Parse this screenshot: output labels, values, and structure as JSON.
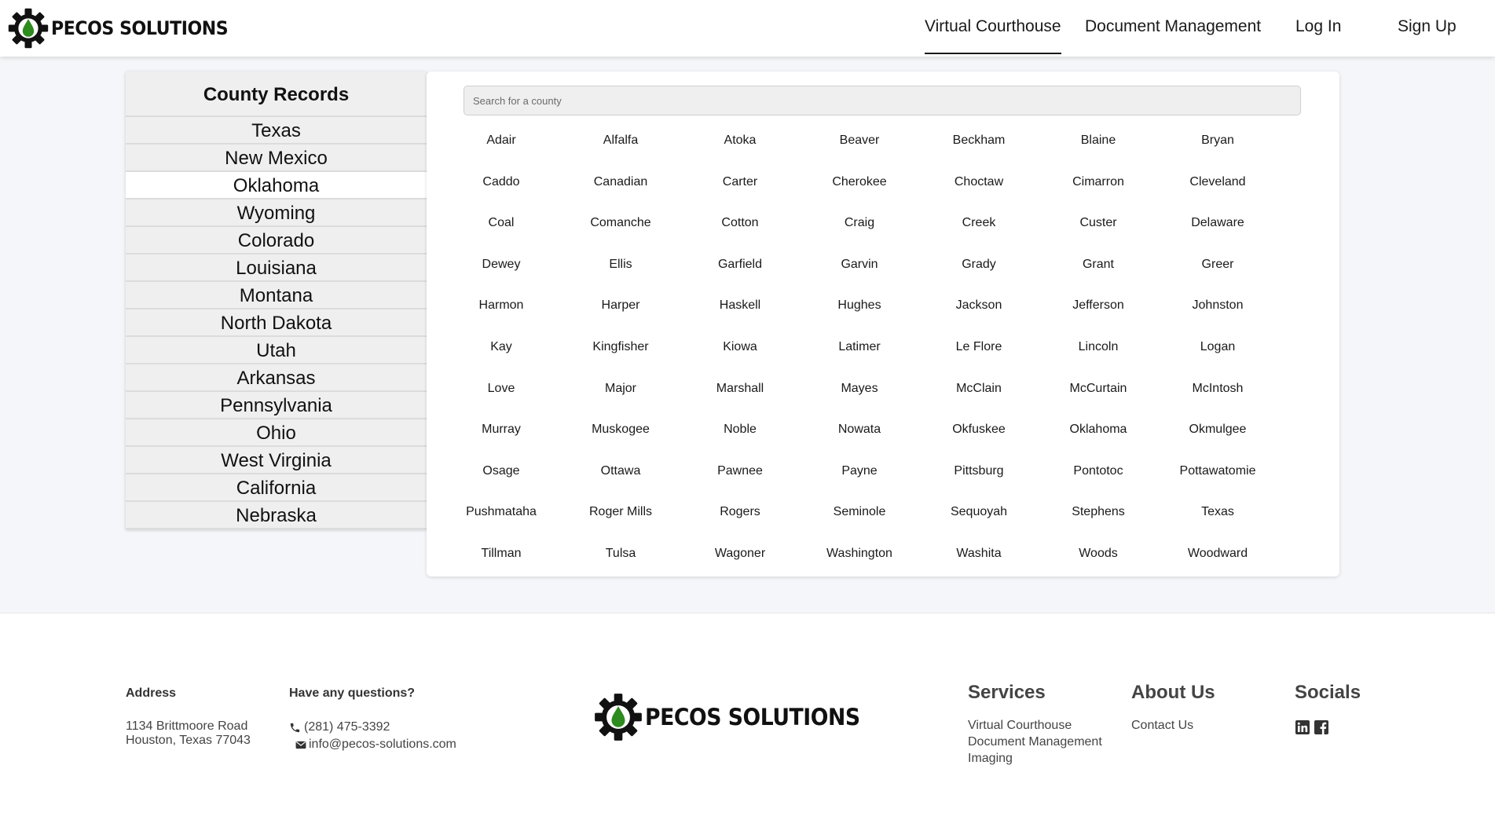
{
  "header": {
    "brand": "PECOS SOLUTIONS",
    "nav": [
      {
        "label": "Virtual Courthouse",
        "active": true
      },
      {
        "label": "Document Management",
        "active": false
      },
      {
        "label": "Log In",
        "active": false
      },
      {
        "label": "Sign Up",
        "active": false
      }
    ]
  },
  "sidebar": {
    "title": "County Records",
    "selected": "Oklahoma",
    "states": [
      "Texas",
      "New Mexico",
      "Oklahoma",
      "Wyoming",
      "Colorado",
      "Louisiana",
      "Montana",
      "North Dakota",
      "Utah",
      "Arkansas",
      "Pennsylvania",
      "Ohio",
      "West Virginia",
      "California",
      "Nebraska"
    ]
  },
  "panel": {
    "search_placeholder": "Search for a county",
    "counties": [
      "Adair",
      "Alfalfa",
      "Atoka",
      "Beaver",
      "Beckham",
      "Blaine",
      "Bryan",
      "Caddo",
      "Canadian",
      "Carter",
      "Cherokee",
      "Choctaw",
      "Cimarron",
      "Cleveland",
      "Coal",
      "Comanche",
      "Cotton",
      "Craig",
      "Creek",
      "Custer",
      "Delaware",
      "Dewey",
      "Ellis",
      "Garfield",
      "Garvin",
      "Grady",
      "Grant",
      "Greer",
      "Harmon",
      "Harper",
      "Haskell",
      "Hughes",
      "Jackson",
      "Jefferson",
      "Johnston",
      "Kay",
      "Kingfisher",
      "Kiowa",
      "Latimer",
      "Le Flore",
      "Lincoln",
      "Logan",
      "Love",
      "Major",
      "Marshall",
      "Mayes",
      "McClain",
      "McCurtain",
      "McIntosh",
      "Murray",
      "Muskogee",
      "Noble",
      "Nowata",
      "Okfuskee",
      "Oklahoma",
      "Okmulgee",
      "Osage",
      "Ottawa",
      "Pawnee",
      "Payne",
      "Pittsburg",
      "Pontotoc",
      "Pottawatomie",
      "Pushmataha",
      "Roger Mills",
      "Rogers",
      "Seminole",
      "Sequoyah",
      "Stephens",
      "Texas",
      "Tillman",
      "Tulsa",
      "Wagoner",
      "Washington",
      "Washita",
      "Woods",
      "Woodward"
    ]
  },
  "footer": {
    "address_heading": "Address",
    "address_line1": "1134 Brittmoore Road",
    "address_line2": "Houston, Texas 77043",
    "questions_heading": "Have any questions?",
    "phone": "(281) 475-3392",
    "email": "info@pecos-solutions.com",
    "brand": "PECOS SOLUTIONS",
    "services_heading": "Services",
    "services": [
      "Virtual Courthouse",
      "Document Management",
      "Imaging"
    ],
    "about_heading": "About Us",
    "about_links": [
      "Contact Us"
    ],
    "socials_heading": "Socials",
    "socials": [
      "linkedin-icon",
      "facebook-icon"
    ]
  },
  "colors": {
    "logo_drop": "#2e8b1e",
    "page_background": "#f5f6f9",
    "sidebar_background": "#efefef",
    "selected_state_background": "#ffffff"
  }
}
